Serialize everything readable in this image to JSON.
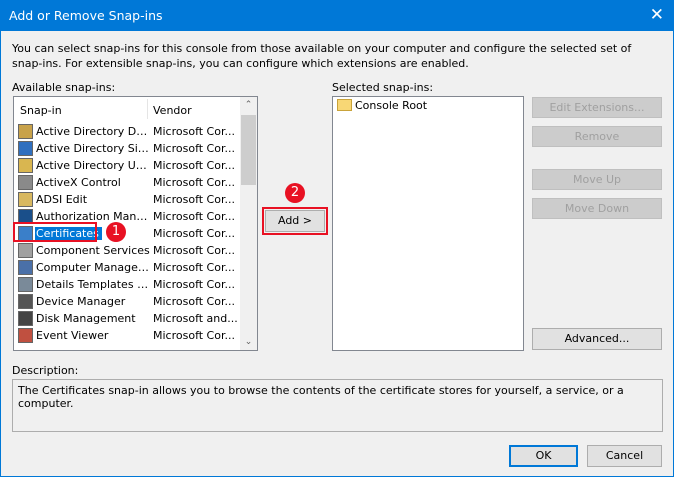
{
  "window": {
    "title": "Add or Remove Snap-ins",
    "close_icon": "close-icon"
  },
  "intro": "You can select snap-ins for this console from those available on your computer and configure the selected set of snap-ins. For extensible snap-ins, you can configure which extensions are enabled.",
  "available": {
    "label": "Available snap-ins:",
    "columns": [
      "Snap-in",
      "Vendor"
    ],
    "items": [
      {
        "name": "Active Directory Do...",
        "vendor": "Microsoft Cor...",
        "icon": "ad-domains-icon"
      },
      {
        "name": "Active Directory Site...",
        "vendor": "Microsoft Cor...",
        "icon": "ad-sites-icon"
      },
      {
        "name": "Active Directory Use...",
        "vendor": "Microsoft Cor...",
        "icon": "ad-users-icon"
      },
      {
        "name": "ActiveX Control",
        "vendor": "Microsoft Cor...",
        "icon": "activex-icon"
      },
      {
        "name": "ADSI Edit",
        "vendor": "Microsoft Cor...",
        "icon": "adsi-edit-icon"
      },
      {
        "name": "Authorization Manager",
        "vendor": "Microsoft Cor...",
        "icon": "authorization-icon"
      },
      {
        "name": "Certificates",
        "vendor": "Microsoft Cor...",
        "icon": "certificates-icon",
        "selected": true
      },
      {
        "name": "Component Services",
        "vendor": "Microsoft Cor...",
        "icon": "component-services-icon"
      },
      {
        "name": "Computer Managem...",
        "vendor": "Microsoft Cor...",
        "icon": "computer-management-icon"
      },
      {
        "name": "Details Templates E...",
        "vendor": "Microsoft Cor...",
        "icon": "details-templates-icon"
      },
      {
        "name": "Device Manager",
        "vendor": "Microsoft Cor...",
        "icon": "device-manager-icon"
      },
      {
        "name": "Disk Management",
        "vendor": "Microsoft and...",
        "icon": "disk-management-icon"
      },
      {
        "name": "Event Viewer",
        "vendor": "Microsoft Cor...",
        "icon": "event-viewer-icon"
      }
    ]
  },
  "add_button": "Add >",
  "badges": [
    "1",
    "2"
  ],
  "selected": {
    "label": "Selected snap-ins:",
    "items": [
      {
        "name": "Console Root",
        "icon": "folder-icon"
      }
    ]
  },
  "buttons": {
    "edit_extensions": "Edit Extensions...",
    "remove": "Remove",
    "move_up": "Move Up",
    "move_down": "Move Down",
    "advanced": "Advanced...",
    "ok": "OK",
    "cancel": "Cancel"
  },
  "description": {
    "label": "Description:",
    "text": "The Certificates snap-in allows you to browse the contents of the certificate stores for yourself, a service, or a computer."
  },
  "colors": {
    "titlebar": "#0078d7",
    "selection": "#0078d7",
    "highlight": "#e81123"
  }
}
